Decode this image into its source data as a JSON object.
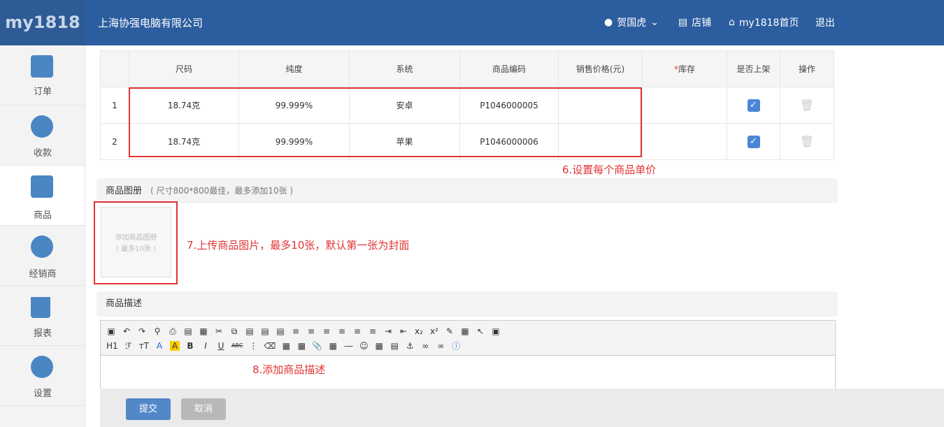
{
  "header": {
    "logo": "my1818",
    "company": "上海协强电脑有限公司",
    "user": "贺国虎",
    "store": "店铺",
    "home": "my1818首页",
    "logout": "退出"
  },
  "sidebar": {
    "items": [
      {
        "label": "订单"
      },
      {
        "label": "收款"
      },
      {
        "label": "商品"
      },
      {
        "label": "经销商"
      },
      {
        "label": "报表"
      },
      {
        "label": "设置"
      }
    ]
  },
  "table": {
    "columns": [
      "尺码",
      "纯度",
      "系统",
      "商品编码",
      "销售价格(元)",
      "库存",
      "是否上架",
      "操作"
    ],
    "required_mark": "*",
    "rows": [
      {
        "index": "1",
        "size": "18.74克",
        "purity": "99.999%",
        "system": "安卓",
        "code": "P1046000005"
      },
      {
        "index": "2",
        "size": "18.74克",
        "purity": "99.999%",
        "system": "苹果",
        "code": "P1046000006"
      }
    ]
  },
  "annotations": {
    "a6": "6.设置每个商品单价",
    "a7": "7.上传商品图片，最多10张，默认第一张为封面",
    "a8": "8.添加商品描述"
  },
  "gallery": {
    "title": "商品图册",
    "hint": "( 尺寸800*800最佳，最多添加10张 )",
    "upload_line1": "添加商品图册",
    "upload_line2": "( 最多10张 )"
  },
  "description": {
    "title": "商品描述"
  },
  "editor": {
    "h1": "H1",
    "font": "ℱ",
    "size": "тT",
    "fontcolor": "A",
    "bg": "A",
    "bold": "B",
    "italic": "I",
    "underline": "U",
    "strike": "ABC"
  },
  "buttons": {
    "submit": "提交",
    "cancel": "取消"
  },
  "colors": {
    "header": "#2b5d9f",
    "accent": "#4a86d8",
    "annotation": "#e03434"
  }
}
